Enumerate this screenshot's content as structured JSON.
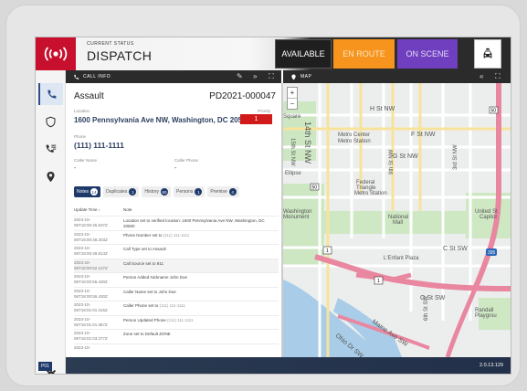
{
  "header": {
    "status_label": "CURRENT STATUS",
    "status_value": "DISPATCH",
    "buttons": {
      "available": "AVAILABLE",
      "en_route": "EN ROUTE",
      "on_scene": "ON SCENE"
    },
    "colors": {
      "brand": "#c8102e",
      "en_route": "#f7941d",
      "on_scene": "#6f3fbf"
    }
  },
  "nav": {
    "unit_badge": "P01",
    "icons": [
      "phone-icon",
      "shield-icon",
      "call-list-icon",
      "location-pin-icon",
      "gear-icon"
    ]
  },
  "call_panel": {
    "title": "CALL INFO",
    "call_type": "Assault",
    "call_id": "PD2021-000047",
    "location_label": "Location",
    "location": "1600 Pennsylvania Ave NW, Washington, DC 20500",
    "priority_label": "Priority",
    "priority": "1",
    "phone_label": "Phone",
    "phone": "(111) 111-1111",
    "caller_name_label": "Caller Name",
    "caller_name": "-",
    "caller_phone_label": "Caller Phone",
    "caller_phone": "-",
    "tabs": [
      {
        "label": "Notes",
        "count": "14"
      },
      {
        "label": "Duplicates",
        "count": "1"
      },
      {
        "label": "History",
        "count": "60"
      },
      {
        "label": "Persons",
        "count": "1"
      },
      {
        "label": "Premise",
        "count": "4"
      }
    ],
    "notes_header": {
      "time": "Update Time",
      "note": "Note"
    },
    "notes": [
      {
        "time": "2023-10-06T18:00:45.537Z",
        "note": "Location set to verified location: 1600 Pennsylvania Ave NW, Washington, DC 20500",
        "hl": ""
      },
      {
        "time": "2023-10-06T18:00:48.203Z",
        "note": "Phone Number set to ",
        "hl": "(111) 111-1111"
      },
      {
        "time": "2023-10-06T18:00:49.813Z",
        "note": "Call Type set to Assault",
        "hl": ""
      },
      {
        "time": "2023-10-06T18:00:52.127Z",
        "note": "Call Source set to 911",
        "hl": ""
      },
      {
        "time": "2023-10-06T18:00:56.430Z",
        "note": "Person Added Nickname John Doe",
        "hl": ""
      },
      {
        "time": "2023-10-06T18:00:59.430Z",
        "note": "Caller Name set to John Doe",
        "hl": ""
      },
      {
        "time": "2023-10-06T18:01:01.315Z",
        "note": "Caller Phone set to ",
        "hl": "(111) 111-1111"
      },
      {
        "time": "2023-10-06T18:01:01.367Z",
        "note": "Person Updated Phone ",
        "hl": "(111) 111-1111"
      },
      {
        "time": "2023-10-06T18:01:03.277Z",
        "note": "Zone set to Default ZONE",
        "hl": ""
      },
      {
        "time": "2023-10-",
        "note": "",
        "hl": ""
      }
    ]
  },
  "map_panel": {
    "title": "MAP",
    "labels": [
      "H St NW",
      "14th St NW",
      "15th St NW",
      "Metro Center",
      "Metro Station",
      "F St NW",
      "G St NW",
      "9th St NW",
      "3rd St NW",
      "Federal Triangle",
      "Metro Station",
      "National Mall",
      "C St SW",
      "L'Enfant Plaza",
      "G St SW",
      "Maine Ave SW",
      "Ohio Dr SW",
      "6th St SW",
      "Randall Playground",
      "United States Capitol",
      "Washington Monument",
      "Ellipse",
      "Square"
    ],
    "route_shields": [
      "50",
      "1",
      "1",
      "395",
      "50"
    ]
  },
  "footer": {
    "version": "2.0.13.129"
  }
}
